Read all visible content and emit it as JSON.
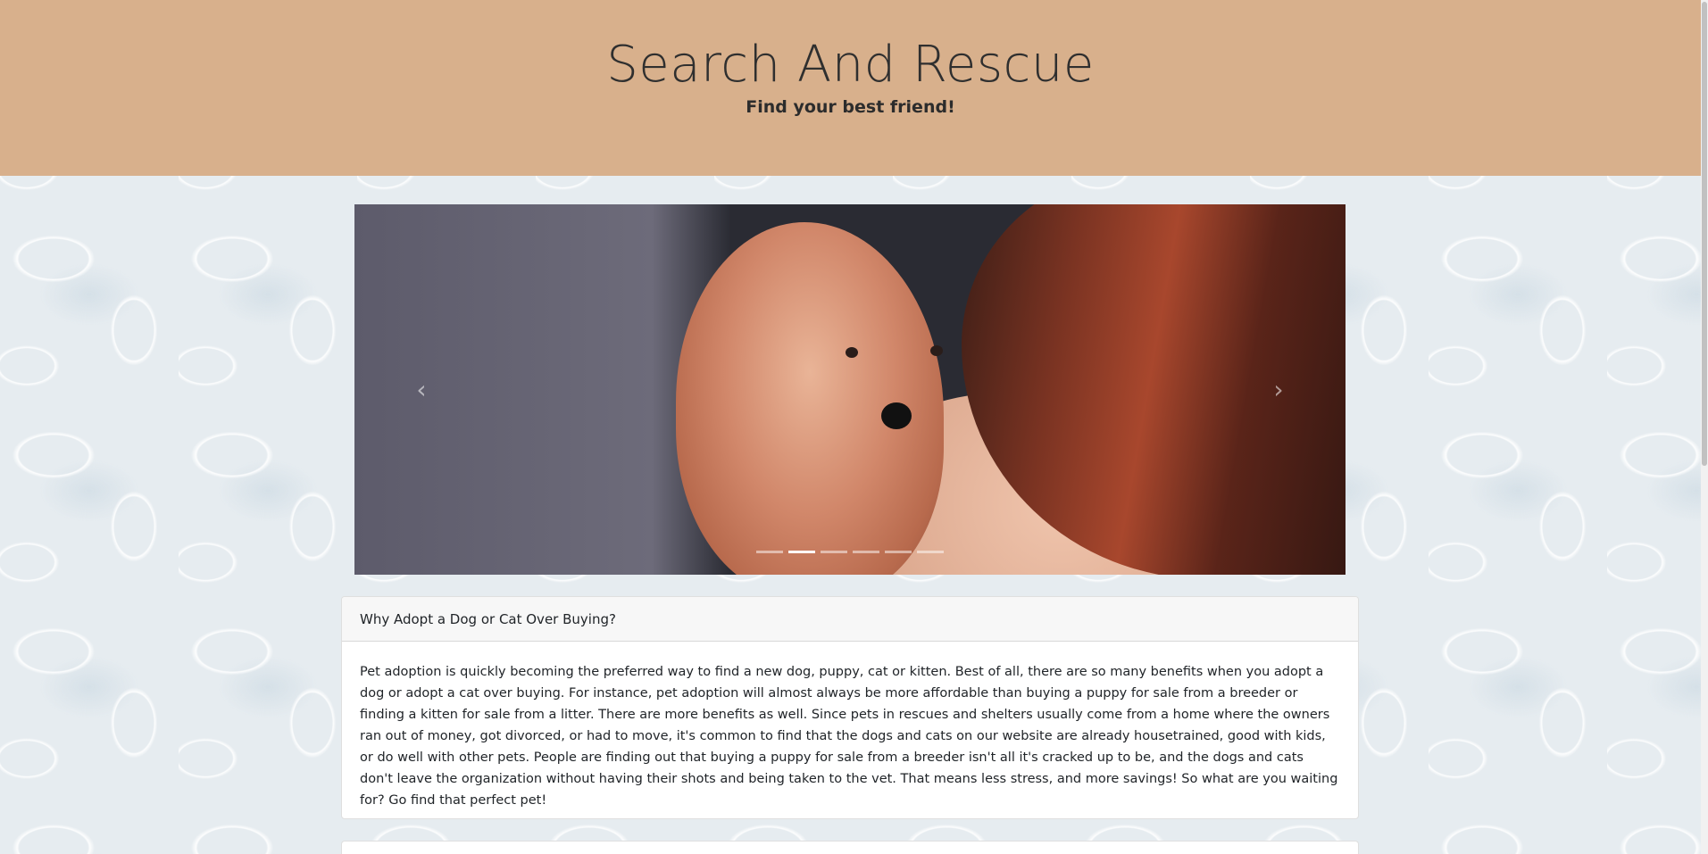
{
  "header": {
    "title": "Search And Rescue",
    "subtitle": "Find your best friend!"
  },
  "carousel": {
    "prev_icon": "chevron-left-icon",
    "next_icon": "chevron-right-icon",
    "prev_glyph": "‹",
    "next_glyph": "›",
    "slide_count": 6,
    "active_slide_index": 1
  },
  "card": {
    "header": "Why Adopt a Dog or Cat Over Buying?",
    "body": "Pet adoption is quickly becoming the preferred way to find a new dog, puppy, cat or kitten. Best of all, there are so many benefits when you adopt a dog or adopt a cat over buying. For instance, pet adoption will almost always be more affordable than buying a puppy for sale from a breeder or finding a kitten for sale from a litter. There are more benefits as well. Since pets in rescues and shelters usually come from a home where the owners ran out of money, got divorced, or had to move, it's common to find that the dogs and cats on our website are already housetrained, good with kids, or do well with other pets. People are finding out that buying a puppy for sale from a breeder isn't all it's cracked up to be, and the dogs and cats don't leave the organization without having their shots and being taken to the vet. That means less stress, and more savings! So what are you waiting for? Go find that perfect pet!"
  },
  "colors": {
    "header_bg": "#d8b08c",
    "page_bg": "#e6ecf0"
  }
}
